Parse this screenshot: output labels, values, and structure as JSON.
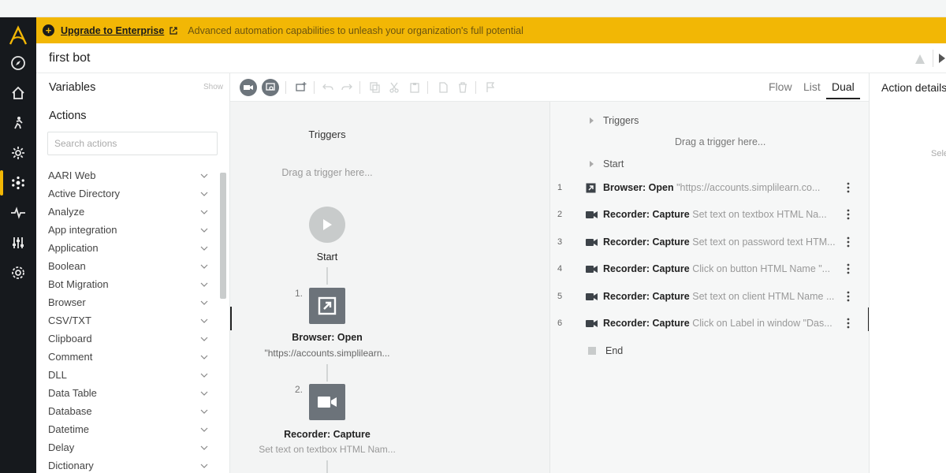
{
  "banner": {
    "upgrade_label": "Upgrade to Enterprise",
    "message": "Advanced automation capabilities to unleash your organization's full potential"
  },
  "bot": {
    "title": "first bot"
  },
  "left_panel": {
    "variables_label": "Variables",
    "show_label": "Show",
    "actions_label": "Actions",
    "search_placeholder": "Search actions",
    "actions": [
      "AARI Web",
      "Active Directory",
      "Analyze",
      "App integration",
      "Application",
      "Boolean",
      "Bot Migration",
      "Browser",
      "CSV/TXT",
      "Clipboard",
      "Comment",
      "DLL",
      "Data Table",
      "Database",
      "Datetime",
      "Delay",
      "Dictionary"
    ]
  },
  "view_tabs": {
    "flow": "Flow",
    "list": "List",
    "dual": "Dual",
    "active": "Dual"
  },
  "flow": {
    "triggers_label": "Triggers",
    "drag_trigger": "Drag a trigger here...",
    "start_label": "Start",
    "steps": [
      {
        "number": "1.",
        "title": "Browser: Open",
        "subtitle": "\"https://accounts.simplilearn..."
      },
      {
        "number": "2.",
        "title": "Recorder: Capture",
        "subtitle": "Set text on textbox HTML Nam..."
      }
    ]
  },
  "list": {
    "triggers_label": "Triggers",
    "drag_trigger": "Drag a trigger here...",
    "start_label": "Start",
    "end_label": "End",
    "rows": [
      {
        "n": "1",
        "icon": "external-link-icon",
        "action": "Browser: Open",
        "detail": "\"https://accounts.simplilearn.co..."
      },
      {
        "n": "2",
        "icon": "video-camera-icon",
        "action": "Recorder: Capture",
        "detail": "Set text on textbox HTML Na..."
      },
      {
        "n": "3",
        "icon": "video-camera-icon",
        "action": "Recorder: Capture",
        "detail": "Set text on password text HTM..."
      },
      {
        "n": "4",
        "icon": "video-camera-icon",
        "action": "Recorder: Capture",
        "detail": "Click on button HTML Name \"..."
      },
      {
        "n": "5",
        "icon": "video-camera-icon",
        "action": "Recorder: Capture",
        "detail": "Set text on client HTML Name ..."
      },
      {
        "n": "6",
        "icon": "video-camera-icon",
        "action": "Recorder: Capture",
        "detail": "Click on Label in window \"Das..."
      }
    ]
  },
  "right_panel": {
    "title": "Action details",
    "hint": "Sele"
  },
  "colors": {
    "accent": "#f2b705",
    "nav_bg": "#16191d",
    "step_box": "#6c737a"
  }
}
